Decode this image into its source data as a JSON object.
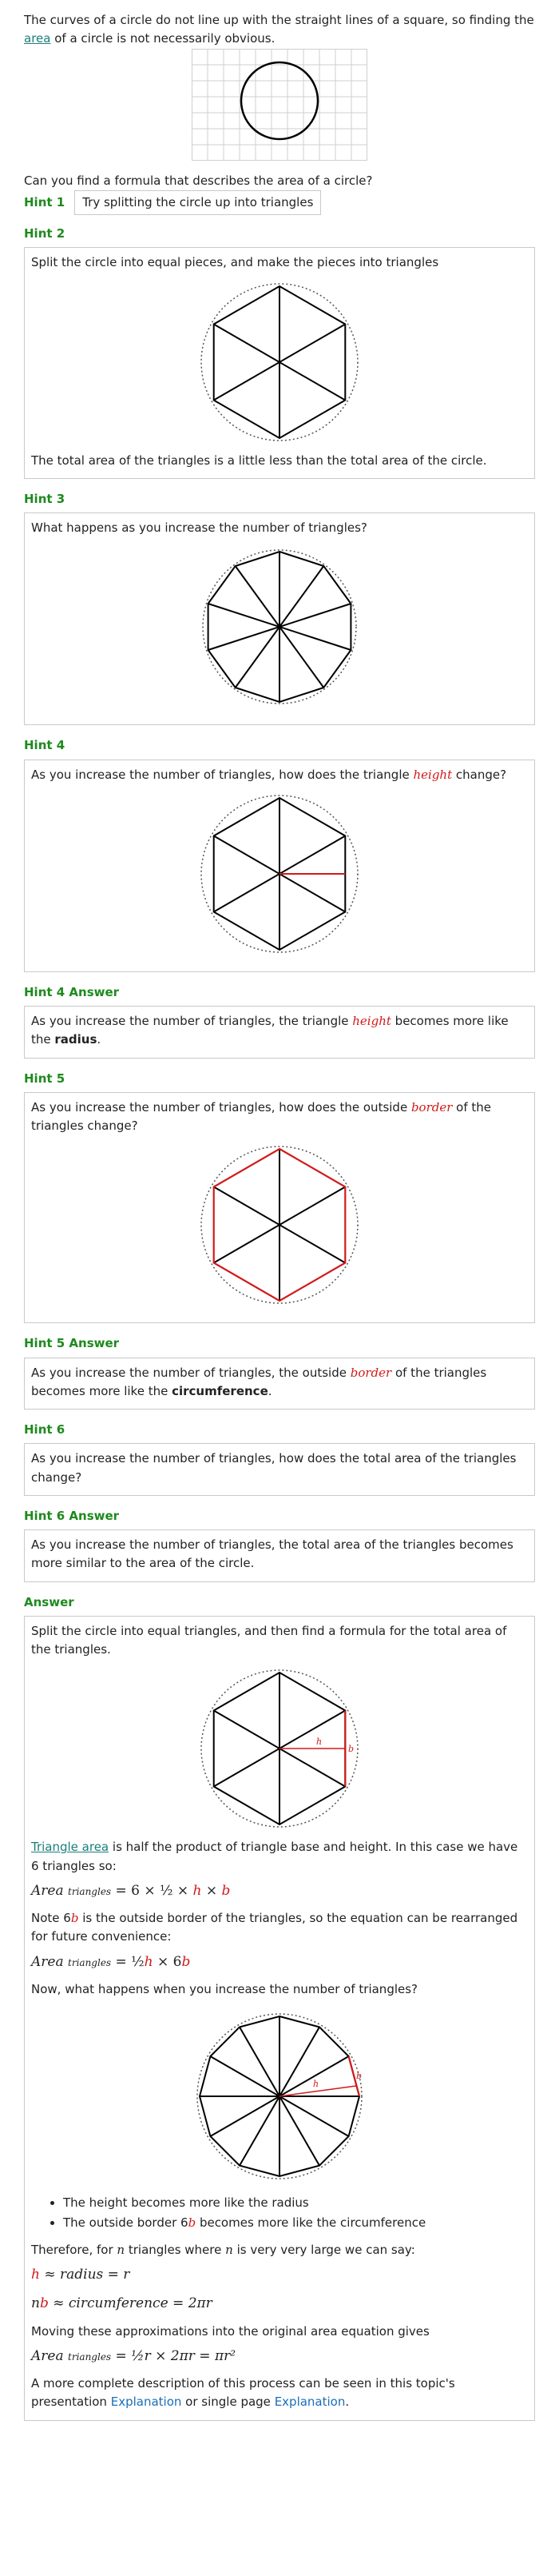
{
  "intro": {
    "text_before": "The curves of a circle do not line up with the straight lines of a square, so finding the ",
    "area_link": "area",
    "text_after": " of a circle is not necessarily obvious."
  },
  "question": "Can you find a formula that describes the area of a circle?",
  "hint1": {
    "label": "Hint 1",
    "text": "Try splitting the circle up into triangles"
  },
  "hint2": {
    "label": "Hint 2",
    "text": "Split the circle into equal pieces, and make the pieces into triangles",
    "caption": "The total area of the triangles is a little less than the total area of the circle."
  },
  "hint3": {
    "label": "Hint 3",
    "text": "What happens as you increase the number of triangles?"
  },
  "hint4": {
    "label": "Hint 4",
    "text_before": "As you increase the number of triangles, how does the triangle ",
    "term": "height",
    "text_after": " change?"
  },
  "hint4_answer": {
    "label": "Hint 4 Answer",
    "text_before": "As you increase the number of triangles, the triangle ",
    "term": "height",
    "text_mid": " becomes more like the ",
    "bold": "radius",
    "text_after": "."
  },
  "hint5": {
    "label": "Hint 5",
    "text_before": "As you increase the number of triangles, how does the outside ",
    "term": "border",
    "text_after": " of the triangles change?"
  },
  "hint5_answer": {
    "label": "Hint 5 Answer",
    "text_before": "As you increase the number of triangles, the outside ",
    "term": "border",
    "text_mid": " of the triangles becomes more like the ",
    "bold": "circumference",
    "text_after": "."
  },
  "hint6": {
    "label": "Hint 6",
    "text": "As you increase the number of triangles, how does the total area of the triangles change?"
  },
  "hint6_answer": {
    "label": "Hint 6 Answer",
    "text": "As you increase the number of triangles, the total area of the triangles becomes more similar to the area of the circle."
  },
  "answer": {
    "label": "Answer",
    "intro": "Split the circle into equal triangles, and then find a formula for the total area of the triangles.",
    "fig_h": "h",
    "fig_b": "b",
    "tri_link": "Triangle area",
    "tri_text": " is half the product of triangle base and height. In this case we have 6 triangles so:",
    "f1_area": "Area",
    "f1_sub": "triangles",
    "f1_rhs": " = 6 × ½ × ",
    "f1_h": "h",
    "f1_times": " × ",
    "f1_b": "b",
    "note_before": "Note 6",
    "note_b": "b",
    "note_after": " is the outside border of the triangles, so the equation can be rearranged for future convenience:",
    "f2_area": "Area",
    "f2_sub": "triangles",
    "f2_rhs": " = ½",
    "f2_h": "h",
    "f2_times": " × 6",
    "f2_b": "b",
    "now": "Now, what happens when you increase the number of triangles?",
    "bullet1": "The height becomes more like the radius",
    "bullet2_before": "The outside border 6",
    "bullet2_b": "b",
    "bullet2_after": " becomes more like the circumference",
    "therefore_before": "Therefore, for ",
    "therefore_n": "n",
    "therefore_after": " triangles where ",
    "therefore_n2": "n",
    "therefore_end": " is very very large we can say:",
    "f3_h": "h",
    "f3_rest": " ≈ radius = r",
    "f4_n": "n",
    "f4_b": "b",
    "f4_rest": " ≈ circumference = 2πr",
    "moving": "Moving these approximations into the original area equation gives",
    "f5_area": "Area",
    "f5_sub": "triangles",
    "f5_rhs": " = ½r × 2πr = πr²",
    "more_before": "A more complete description of this process can be seen in this topic's presentation ",
    "more_link1": "Explanation",
    "more_mid": " or single page ",
    "more_link2": "Explanation",
    "more_end": "."
  },
  "colors": {
    "hint_label": "#1e8a1e",
    "highlight": "#d11a1a",
    "link": "#1a6fb7"
  }
}
